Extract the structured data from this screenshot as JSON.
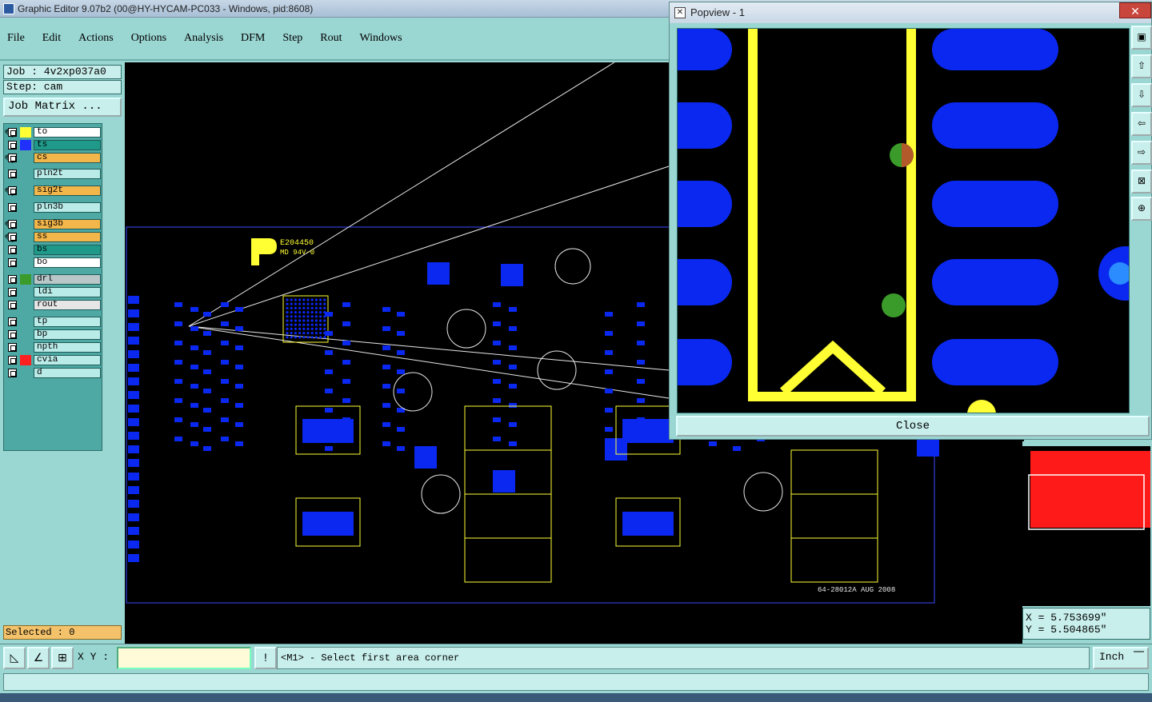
{
  "window": {
    "title": "Graphic Editor 9.07b2 (00@HY-HYCAM-PC033 - Windows, pid:8608)"
  },
  "menu": [
    {
      "label": "File"
    },
    {
      "label": "Edit"
    },
    {
      "label": "Actions"
    },
    {
      "label": "Options"
    },
    {
      "label": "Analysis"
    },
    {
      "label": "DFM"
    },
    {
      "label": "Step"
    },
    {
      "label": "Rout"
    },
    {
      "label": "Windows"
    }
  ],
  "job": {
    "job_label": "Job  : 4v2xp037a0",
    "step_label": "Step: cam",
    "matrix_button": "Job Matrix ..."
  },
  "layers": [
    {
      "name": "to",
      "bg": "#ffffff",
      "swatch": "#ffff33",
      "edit": true
    },
    {
      "name": "ts",
      "bg": "#1f9a8a",
      "swatch": "#2030ff",
      "edit": false
    },
    {
      "name": "cs",
      "bg": "#f3b64a",
      "swatch": "",
      "edit": true
    },
    {
      "name": "pln2t",
      "bg": "#b9ebe8",
      "swatch": "",
      "edit": false
    },
    {
      "name": "sig2t",
      "bg": "#f3b64a",
      "swatch": "",
      "edit": true
    },
    {
      "name": "pln3b",
      "bg": "#b9ebe8",
      "swatch": "",
      "edit": false
    },
    {
      "name": "sig3b",
      "bg": "#f3b64a",
      "swatch": "",
      "edit": true
    },
    {
      "name": "ss",
      "bg": "#f3b64a",
      "swatch": "",
      "edit": true
    },
    {
      "name": "bs",
      "bg": "#1f9a8a",
      "swatch": "",
      "edit": false
    },
    {
      "name": "bo",
      "bg": "#ffffff",
      "swatch": "",
      "edit": false
    },
    {
      "name": "drl",
      "bg": "#b9c7c9",
      "swatch": "#3a9a2a",
      "edit": false
    },
    {
      "name": "ldi",
      "bg": "#b9ebe8",
      "swatch": "",
      "edit": false
    },
    {
      "name": "rout",
      "bg": "#e6e6e6",
      "swatch": "",
      "edit": false
    },
    {
      "name": "tp",
      "bg": "#b9ebe8",
      "swatch": "",
      "edit": false
    },
    {
      "name": "bp",
      "bg": "#b9ebe8",
      "swatch": "",
      "edit": false
    },
    {
      "name": "npth",
      "bg": "#b9ebe8",
      "swatch": "",
      "edit": false
    },
    {
      "name": "cvia",
      "bg": "#b9ebe8",
      "swatch": "#ff2020",
      "edit": false
    },
    {
      "name": "d",
      "bg": "#b9ebe8",
      "swatch": "",
      "edit": false
    }
  ],
  "selected": "Selected : 0",
  "board": {
    "marking1": "E204450",
    "marking2": "MD 94V-0",
    "date_code": "64-28012A AUG 2008"
  },
  "popview": {
    "title": "Popview - 1",
    "close_label": "Close",
    "close_x": "✕"
  },
  "coords": {
    "x": "X = 5.753699\"",
    "y": "Y = 5.504865\""
  },
  "status": {
    "xy_label": "X Y :",
    "xy_value": "",
    "prompt": "<M1> - Select first area corner",
    "units": "Inch"
  },
  "colors": {
    "pad": "#0a28f0",
    "silk": "#ffff33",
    "panel": "#9ad6d2"
  }
}
